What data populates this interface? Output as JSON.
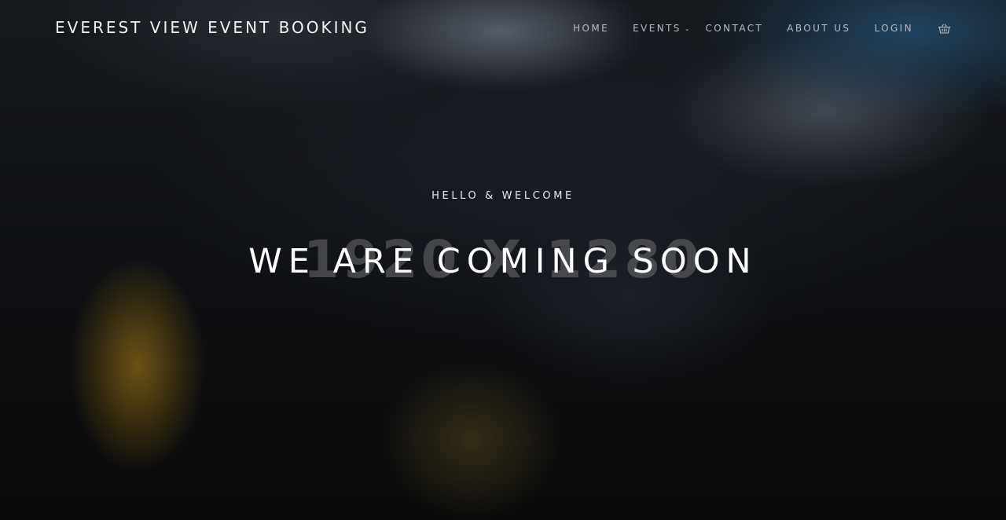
{
  "brand": {
    "name": "EVEREST VIEW EVENT BOOKING"
  },
  "nav": {
    "items": [
      {
        "label": "HOME",
        "name": "nav-home"
      },
      {
        "label": "EVENTS",
        "name": "nav-events",
        "has_dropdown": true
      },
      {
        "label": "CONTACT",
        "name": "nav-contact"
      },
      {
        "label": "ABOUT US",
        "name": "nav-about-us"
      },
      {
        "label": "LOGIN",
        "name": "nav-login"
      }
    ],
    "cart_icon": "basket-icon",
    "dropdown_icon": "chevron-down-icon"
  },
  "hero": {
    "placeholder_text": "1920 X 1280",
    "eyebrow": "HELLO & WELCOME",
    "headline": "WE ARE COMING SOON"
  },
  "colors": {
    "text_primary": "#ffffff",
    "nav_text": "#b8bcc2",
    "background_dark": "#0b0c0e",
    "glow_amber": "#7d5f14",
    "glow_blue": "#234b69"
  }
}
